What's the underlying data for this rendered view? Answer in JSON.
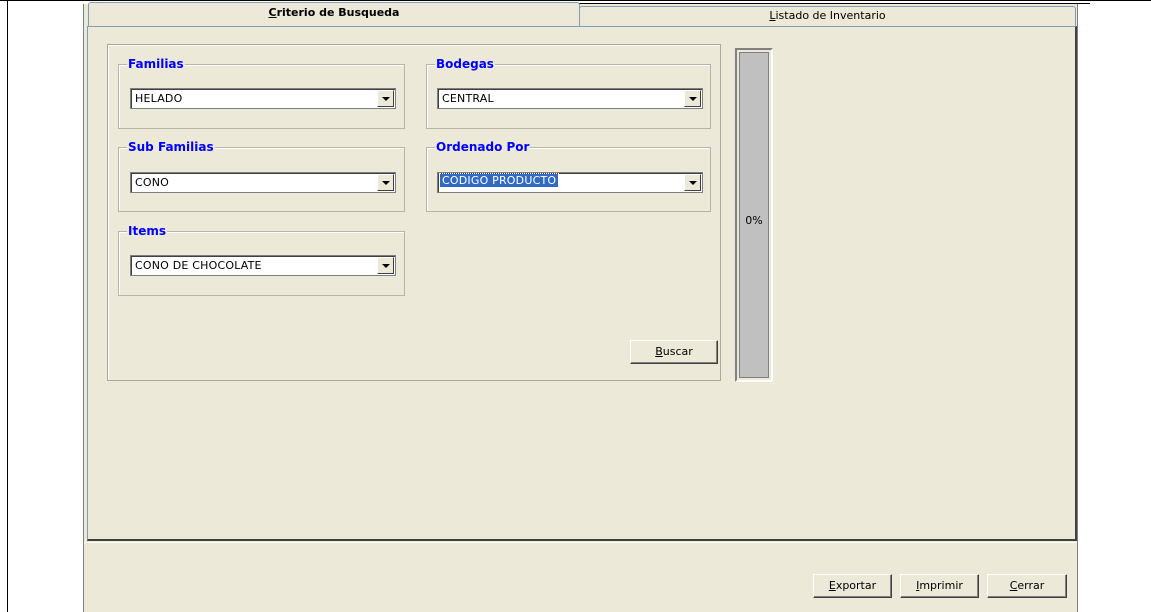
{
  "tabs": {
    "criteria": {
      "label_first": "C",
      "label_rest": "riterio de Busqueda"
    },
    "inventory": {
      "label_first": "L",
      "label_rest": "istado de Inventario"
    }
  },
  "groups": {
    "familias": {
      "label": "Familias",
      "value": "HELADO"
    },
    "bodegas": {
      "label": "Bodegas",
      "value": "CENTRAL"
    },
    "sub_familias": {
      "label": "Sub Familias",
      "value": "CONO"
    },
    "ordenado_por": {
      "label": "Ordenado Por",
      "value": "CODIGO PRODUCTO"
    },
    "items": {
      "label": "Items",
      "value": "CONO DE CHOCOLATE"
    }
  },
  "buttons": {
    "buscar": {
      "first": "B",
      "rest": "uscar"
    },
    "exportar": {
      "first": "E",
      "rest": "xportar"
    },
    "imprimir": {
      "first": "I",
      "rest": "mprimir"
    },
    "cerrar": {
      "first": "C",
      "rest": "errar"
    }
  },
  "progress": {
    "text": "0%",
    "value": 0
  },
  "colors": {
    "group_label": "#0000ff",
    "selection": "#316ac5",
    "window_bg": "#ece9d8"
  },
  "icons": {
    "combo_dropdown": "chevron-down-icon"
  }
}
